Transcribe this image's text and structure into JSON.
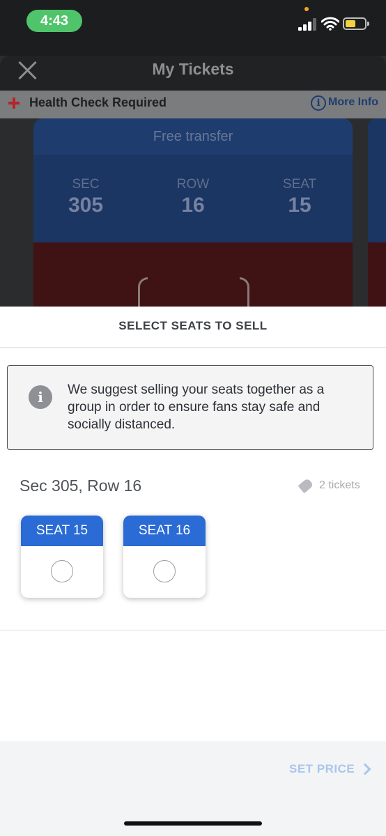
{
  "status_bar": {
    "time": "4:43",
    "battery_color": "#f4d23c",
    "time_pill_color": "#4fc46a"
  },
  "background": {
    "nav_title": "My Tickets",
    "health_check": "Health Check Required",
    "more_info": "More Info",
    "ticket": {
      "header": "Free transfer",
      "sec_label": "SEC",
      "sec_value": "305",
      "row_label": "ROW",
      "row_value": "16",
      "seat_label": "SEAT",
      "seat_value": "15"
    }
  },
  "sheet": {
    "title": "SELECT SEATS TO SELL",
    "notice": "We suggest selling your seats together as a group in order to ensure fans stay safe and socially distanced.",
    "group_title": "Sec 305, Row 16",
    "ticket_count": "2 tickets",
    "seats": [
      {
        "label": "SEAT 15",
        "selected": false
      },
      {
        "label": "SEAT 16",
        "selected": false
      }
    ],
    "accent_color": "#2a6bd6",
    "footer_action": "SET PRICE"
  }
}
